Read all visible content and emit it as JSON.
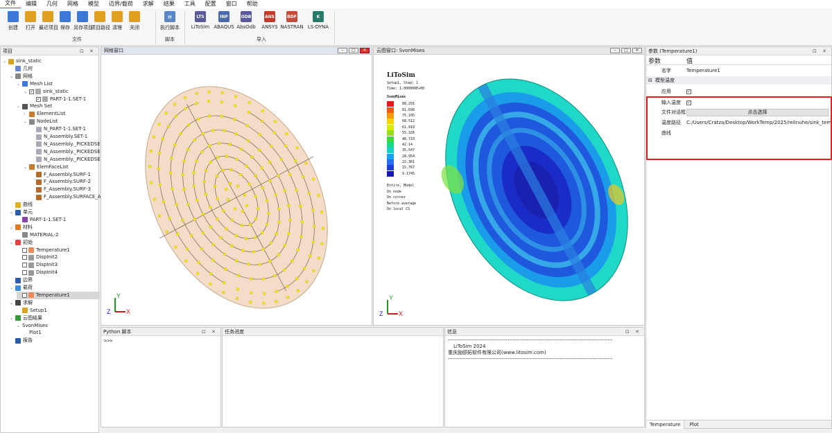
{
  "menubar": {
    "items": [
      "文件",
      "编辑",
      "几何",
      "网格",
      "模型",
      "边界/载荷",
      "求解",
      "结果",
      "工具",
      "配置",
      "窗口",
      "帮助"
    ]
  },
  "ribbon": {
    "file_buttons": [
      "创建",
      "打开",
      "最近项目",
      "保存",
      "另存项目",
      "项目路径",
      "清理",
      "关闭"
    ],
    "file_group_label": "文件",
    "script_button": "执行脚本",
    "script_group_label": "脚本",
    "import_buttons": [
      "LiToSim",
      "ABAQUS",
      "AbsOdb",
      "ANSYS",
      "NASTRAN",
      "LS-DYNA"
    ],
    "import_icons": [
      "LTS",
      "INP",
      "ODB",
      "ANS",
      "BDF",
      "K"
    ],
    "import_group_label": "导入"
  },
  "project": {
    "title": "项目",
    "tree": [
      {
        "label": "sink_static",
        "depth": 0,
        "tw": "v",
        "icon": "#d9a520"
      },
      {
        "label": "几何",
        "depth": 1,
        "icon": "#6688cc"
      },
      {
        "label": "网格",
        "depth": 1,
        "tw": "v",
        "icon": "#888"
      },
      {
        "label": "Mesh List",
        "depth": 2,
        "tw": "v",
        "icon": "#3c78d8"
      },
      {
        "label": "sink_static",
        "depth": 3,
        "tw": "v",
        "cb": "✓",
        "icon": "#aaa"
      },
      {
        "label": "PART-1-1.SET-1",
        "depth": 4,
        "cb": "✓",
        "icon": "#aaa"
      },
      {
        "label": "Mesh Set",
        "depth": 2,
        "tw": "v",
        "icon": "#555"
      },
      {
        "label": "ElementList",
        "depth": 3,
        "tw": ">",
        "icon": "#c87b2c"
      },
      {
        "label": "NodeList",
        "depth": 3,
        "tw": "v",
        "icon": "#888"
      },
      {
        "label": "N_PART-1-1.SET-1",
        "depth": 4,
        "icon": "#aab"
      },
      {
        "label": "N_Assembly.SET-1",
        "depth": 4,
        "icon": "#aab"
      },
      {
        "label": "N_Assembly._PICKEDSE...",
        "depth": 4,
        "icon": "#aab"
      },
      {
        "label": "N_Assembly._PICKEDSE...",
        "depth": 4,
        "icon": "#aab"
      },
      {
        "label": "N_Assembly._PICKEDSE...",
        "depth": 4,
        "icon": "#aab"
      },
      {
        "label": "ElemFaceList",
        "depth": 3,
        "tw": "v",
        "icon": "#c87b2c"
      },
      {
        "label": "F_Assembly.SURF-1",
        "depth": 4,
        "icon": "#b56a2a"
      },
      {
        "label": "F_Assembly.SURF-2",
        "depth": 4,
        "icon": "#b56a2a"
      },
      {
        "label": "F_Assembly.SURF-3",
        "depth": 4,
        "icon": "#b56a2a"
      },
      {
        "label": "F_Assembly.SURFACE_A...",
        "depth": 4,
        "icon": "#b56a2a"
      },
      {
        "label": "曲线",
        "depth": 1,
        "icon": "#e0b020"
      },
      {
        "label": "单元",
        "depth": 1,
        "tw": "v",
        "icon": "#2a5cad"
      },
      {
        "label": "PART-1-1.SET-1",
        "depth": 2,
        "icon": "#8844aa"
      },
      {
        "label": "材料",
        "depth": 1,
        "tw": "v",
        "icon": "#e07b20"
      },
      {
        "label": "MATERIAL-2",
        "depth": 2,
        "icon": "#888"
      },
      {
        "label": "初始",
        "depth": 1,
        "tw": "v",
        "icon": "#d44"
      },
      {
        "label": "Temperature1",
        "depth": 2,
        "cb": " ",
        "icon": "#e85"
      },
      {
        "label": "DispInit2",
        "depth": 2,
        "cb": " ",
        "icon": "#999"
      },
      {
        "label": "DispInit3",
        "depth": 2,
        "cb": " ",
        "icon": "#999"
      },
      {
        "label": "DispInit4",
        "depth": 2,
        "cb": " ",
        "icon": "#999"
      },
      {
        "label": "边界",
        "depth": 1,
        "icon": "#2a5cad"
      },
      {
        "label": "载荷",
        "depth": 1,
        "tw": "v",
        "icon": "#3c8dd8"
      },
      {
        "label": "Temperature1",
        "depth": 2,
        "cb": " ",
        "icon": "#e85",
        "selected": true
      },
      {
        "label": "求解",
        "depth": 1,
        "tw": "v",
        "icon": "#444"
      },
      {
        "label": "Setup1",
        "depth": 2,
        "icon": "#d9a520"
      },
      {
        "label": "云图结果",
        "depth": 1,
        "tw": "v",
        "icon": "#3a9a3a"
      },
      {
        "label": "SvonMises",
        "depth": 2,
        "tw": "v"
      },
      {
        "label": "Plot1",
        "depth": 3
      },
      {
        "label": "报告",
        "depth": 1,
        "icon": "#2a5cad"
      }
    ]
  },
  "mesh_window": {
    "title": "网格窗口"
  },
  "contour_window": {
    "title": "云图窗口: SvonMises"
  },
  "contour_info": {
    "app": "LiToSim",
    "step": "Setup1, Step: 1",
    "time": "Time: 1.000000E+00",
    "variable": "SvonMises",
    "legend_values": [
      "88.291",
      "81.698",
      "75.105",
      "68.512",
      "61.919",
      "55.326",
      "48.733",
      "42.14",
      "35.547",
      "28.954",
      "22.361",
      "15.767",
      "9.1745"
    ],
    "legend_colors": [
      "#e8181c",
      "#ee5a10",
      "#f59a0c",
      "#f8d208",
      "#d8ec08",
      "#96e21a",
      "#3fd93a",
      "#18d88a",
      "#18d0d0",
      "#1aa2ee",
      "#2a6ef0",
      "#1e3cd8",
      "#1818b8"
    ],
    "notes": [
      "Entire, Model",
      "On node",
      "On corner",
      "Before average",
      "On local CS"
    ]
  },
  "python_panel": {
    "title": "Python 脚本",
    "prompt": ">>>"
  },
  "task_panel": {
    "title": "任务进度"
  },
  "info_panel": {
    "title": "信息",
    "rule": "----------------------------------------------------------------------------------------------",
    "line1": "LiToSim 2024",
    "line2": "重庆励颐拓软件有限公司(www.litosim.com)"
  },
  "params": {
    "title": "参数 (Temperature1)",
    "col_param": "参数",
    "col_value": "值",
    "name_key": "名字",
    "name_value": "Temperature1",
    "section": "模型温度",
    "apply_key": "应用",
    "input_temp_key": "输入温度",
    "file_key": "文件对话框",
    "file_button": "点击选择",
    "path_key": "温度路径",
    "path_value": "C:/Users/Cratza/Desktop/WorkTemp/2025/relinuhe/sink_temp/sin...",
    "curve_key": "曲线",
    "tab1": "Temperature",
    "tab2": "Plot",
    "highlight_color": "#e02020"
  }
}
